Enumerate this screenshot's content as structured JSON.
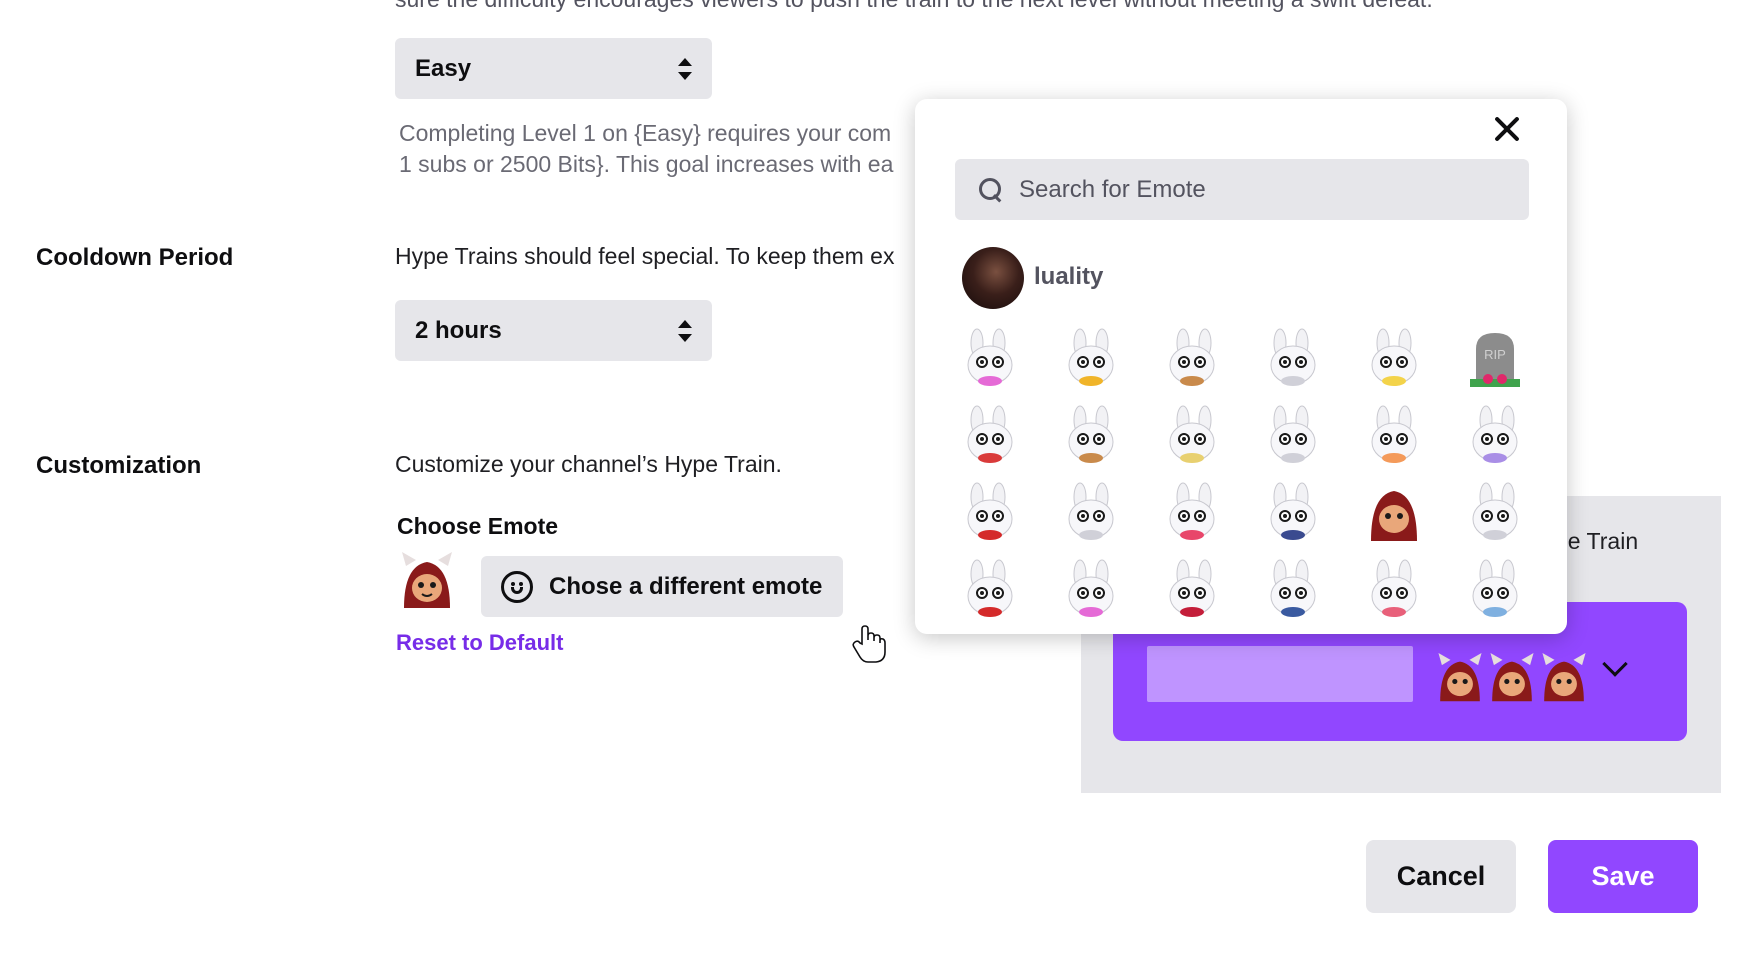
{
  "difficulty": {
    "top_text": "sure the difficulty encourages viewers to push the train to the next level without meeting a swift defeat.",
    "selected": "Easy",
    "helper_line1": "Completing Level 1 on {Easy} requires your com",
    "helper_line2": "1 subs or 2500 Bits}. This goal increases with ea"
  },
  "cooldown": {
    "label": "Cooldown Period",
    "description": "Hype Trains should feel special. To keep them ex",
    "selected": "2 hours"
  },
  "customization": {
    "label": "Customization",
    "description": "Customize your channel’s Hype Train.",
    "choose_label": "Choose Emote",
    "different_button": "Chose a different emote",
    "reset_link": "Reset to Default"
  },
  "preview": {
    "title_fragment": "pe Train",
    "progress_fill": 1.0
  },
  "emote_picker": {
    "search_placeholder": "Search for Emote",
    "channel_name": "luality",
    "emotes": [
      {
        "name": "bunny-emote-1",
        "accent": "#e56ad6"
      },
      {
        "name": "bunny-emote-2",
        "accent": "#f0b429"
      },
      {
        "name": "bunny-emote-3",
        "accent": "#c98a4b"
      },
      {
        "name": "bunny-emote-4",
        "accent": "#d0d0d8"
      },
      {
        "name": "bunny-emote-5",
        "accent": "#f3d34a"
      },
      {
        "name": "tombstone-emote",
        "accent": "#9a9a9a",
        "label": "RIP"
      },
      {
        "name": "bunny-emote-7",
        "accent": "#d93a3a"
      },
      {
        "name": "bunny-emote-8",
        "accent": "#c98a4b"
      },
      {
        "name": "bunny-emote-9",
        "accent": "#e8d070"
      },
      {
        "name": "bunny-emote-10",
        "accent": "#d0d0d8"
      },
      {
        "name": "bunny-emote-11",
        "accent": "#f49a5a"
      },
      {
        "name": "bunny-emote-12",
        "accent": "#a98ee6"
      },
      {
        "name": "bunny-emote-13",
        "accent": "#d42a2a"
      },
      {
        "name": "bunny-emote-14",
        "accent": "#d0d0d8"
      },
      {
        "name": "bunny-emote-15",
        "accent": "#e8466a"
      },
      {
        "name": "bunny-emote-16",
        "accent": "#3a4a8f"
      },
      {
        "name": "hooded-emote",
        "accent": "#8a1a1a"
      },
      {
        "name": "bunny-emote-18",
        "accent": "#d0d0d8"
      },
      {
        "name": "bunny-emote-19",
        "accent": "#d42a2a"
      },
      {
        "name": "bunny-emote-20",
        "accent": "#e56ad6"
      },
      {
        "name": "bunny-emote-21",
        "accent": "#c41e3a"
      },
      {
        "name": "bunny-emote-22",
        "accent": "#3a5aa0"
      },
      {
        "name": "bunny-emote-23",
        "accent": "#e8607a"
      },
      {
        "name": "bunny-emote-24",
        "accent": "#7fb0e0"
      }
    ]
  },
  "actions": {
    "cancel": "Cancel",
    "save": "Save"
  },
  "colors": {
    "accent": "#9147ff",
    "link": "#772ce8",
    "progress": "#bf94ff"
  }
}
